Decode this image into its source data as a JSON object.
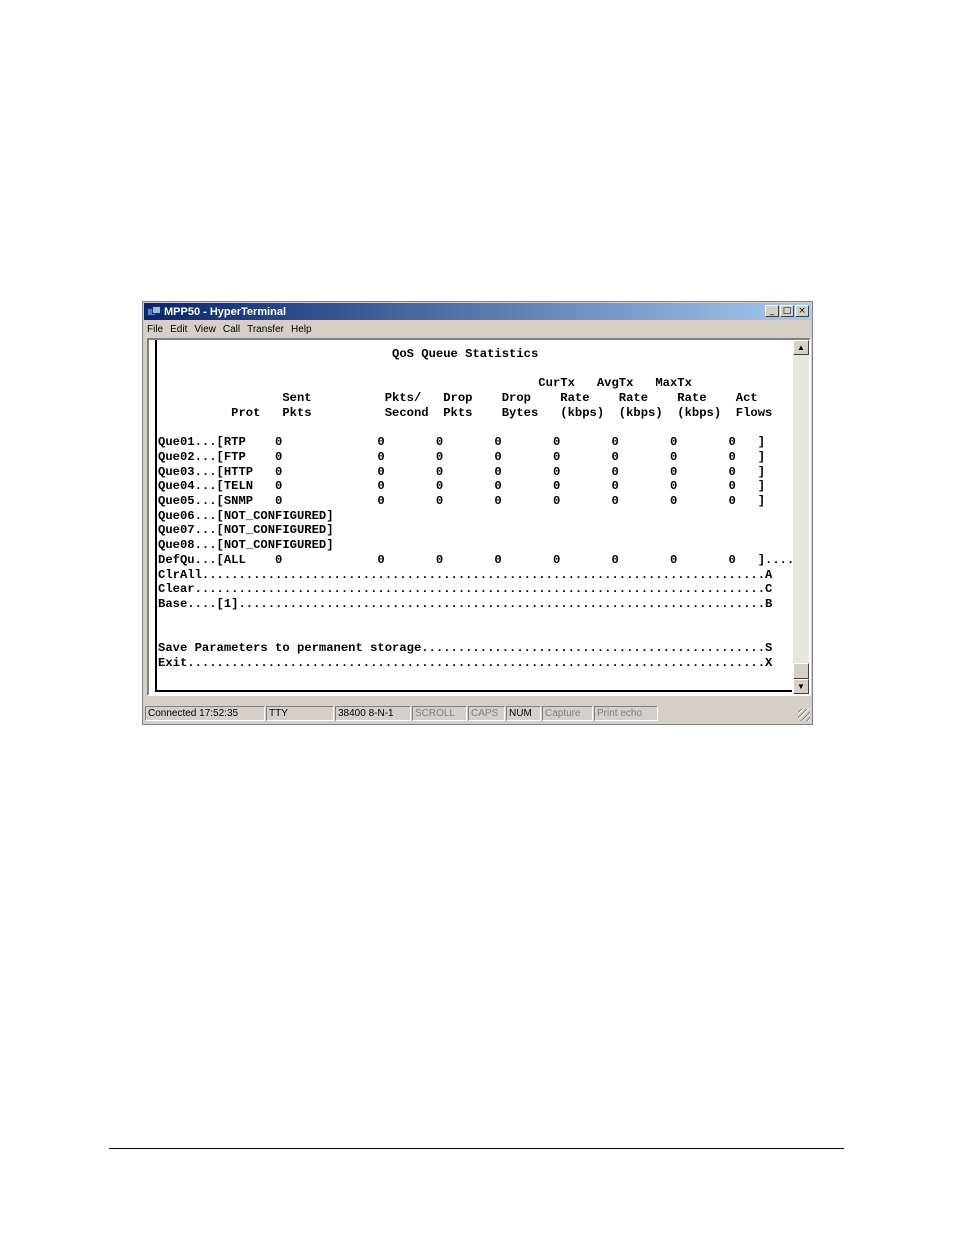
{
  "window": {
    "title": "MPP50 - HyperTerminal"
  },
  "menu": [
    "File",
    "Edit",
    "View",
    "Call",
    "Transfer",
    "Help"
  ],
  "window_buttons": {
    "minimize": "_",
    "maximize": "□",
    "close": "×"
  },
  "terminal": {
    "lines": [
      "                                QoS Queue Statistics",
      "",
      "                                                    CurTx   AvgTx   MaxTx",
      "                 Sent          Pkts/   Drop    Drop    Rate    Rate    Rate    Act",
      "          Prot   Pkts          Second  Pkts    Bytes   (kbps)  (kbps)  (kbps)  Flows",
      "",
      "Que01...[RTP    0             0       0       0       0       0       0       0   ]",
      "Que02...[FTP    0             0       0       0       0       0       0       0   ]",
      "Que03...[HTTP   0             0       0       0       0       0       0       0   ]",
      "Que04...[TELN   0             0       0       0       0       0       0       0   ]",
      "Que05...[SNMP   0             0       0       0       0       0       0       0   ]",
      "Que06...[NOT_CONFIGURED]",
      "Que07...[NOT_CONFIGURED]",
      "Que08...[NOT_CONFIGURED]",
      "DefQu...[ALL    0             0       0       0       0       0       0       0   ].....",
      "ClrAll.............................................................................A",
      "Clear..............................................................................C",
      "Base....[1]........................................................................B",
      "",
      "",
      "Save Parameters to permanent storage...............................................S",
      "Exit...............................................................................X"
    ]
  },
  "scroll": {
    "up": "▲",
    "down": "▼"
  },
  "status": {
    "connection": "Connected 17:52:35",
    "emulation": "TTY",
    "settings": "38400 8-N-1",
    "scroll": "SCROLL",
    "caps": "CAPS",
    "num": "NUM",
    "capture": "Capture",
    "print_echo": "Print echo"
  }
}
